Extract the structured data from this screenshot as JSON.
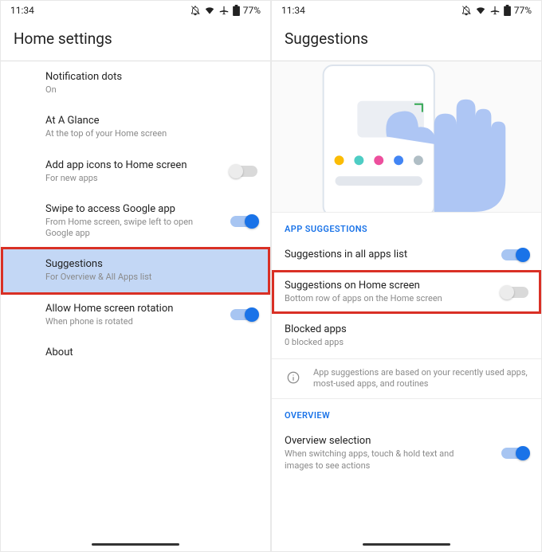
{
  "status": {
    "time": "11:34",
    "battery": "77%"
  },
  "left": {
    "title": "Home settings",
    "items": [
      {
        "title": "Notification dots",
        "sub": "On",
        "toggle": null
      },
      {
        "title": "At A Glance",
        "sub": "At the top of your Home screen",
        "toggle": null
      },
      {
        "title": "Add app icons to Home screen",
        "sub": "For new apps",
        "toggle": "off"
      },
      {
        "title": "Swipe to access Google app",
        "sub": "From Home screen, swipe left to open Google app",
        "toggle": "on"
      },
      {
        "title": "Suggestions",
        "sub": "For Overview & All Apps list",
        "toggle": null,
        "highlight": true
      },
      {
        "title": "Allow Home screen rotation",
        "sub": "When phone is rotated",
        "toggle": "on"
      },
      {
        "title": "About",
        "sub": "",
        "toggle": null
      }
    ]
  },
  "right": {
    "title": "Suggestions",
    "section_app": "APP SUGGESTIONS",
    "items_app": [
      {
        "title": "Suggestions in all apps list",
        "sub": "",
        "toggle": "on"
      },
      {
        "title": "Suggestions on Home screen",
        "sub": "Bottom row of apps on the Home screen",
        "toggle": "off",
        "highlight": true
      },
      {
        "title": "Blocked apps",
        "sub": "0 blocked apps",
        "toggle": null
      }
    ],
    "info_text": "App suggestions are based on your recently used apps, most-used apps, and routines",
    "section_overview": "OVERVIEW",
    "items_overview": [
      {
        "title": "Overview selection",
        "sub": "When switching apps, touch & hold text and images to see actions",
        "toggle": "on"
      }
    ]
  }
}
